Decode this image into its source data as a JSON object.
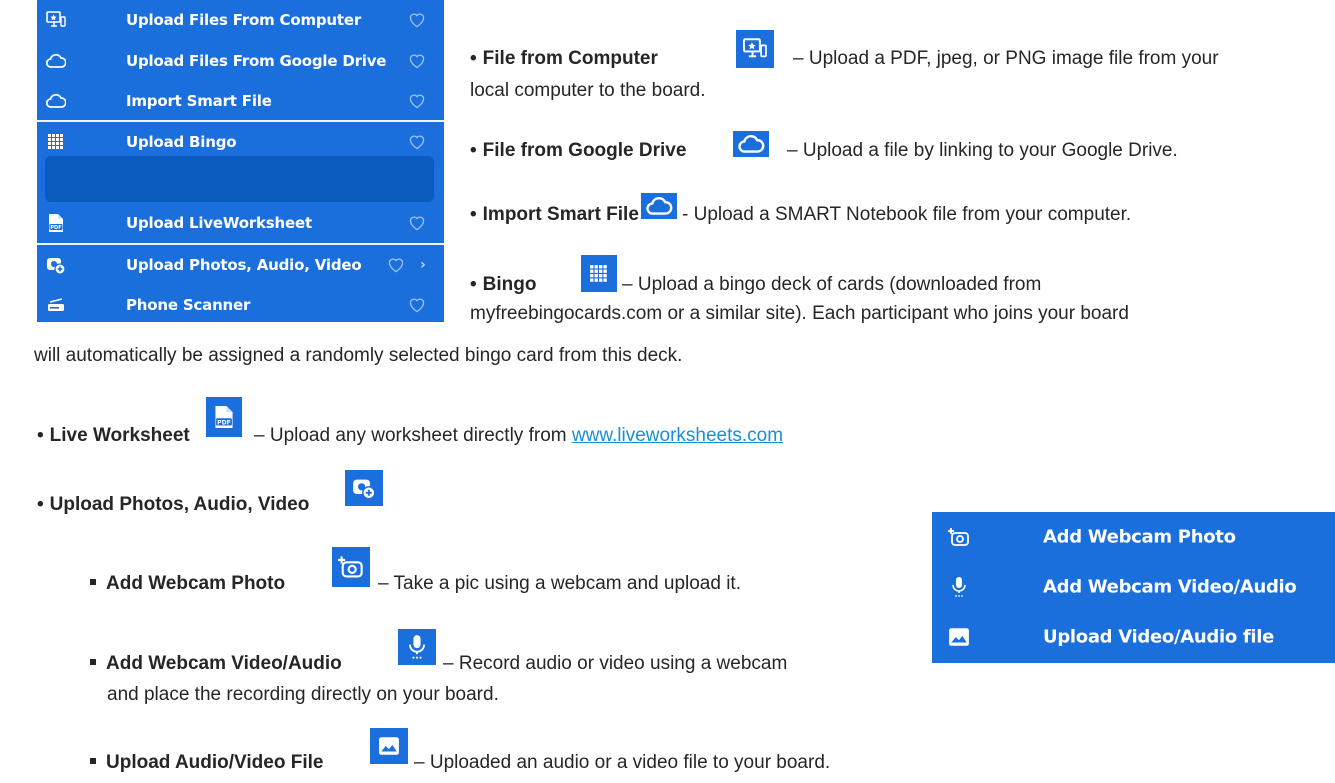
{
  "menu": {
    "items": [
      {
        "label": "Upload Files From Computer",
        "icon": "computer-upload-icon"
      },
      {
        "label": "Upload Files From Google Drive",
        "icon": "cloud-icon"
      },
      {
        "label": "Import Smart File",
        "icon": "cloud-icon"
      },
      {
        "label": "Upload Bingo",
        "icon": "bingo-grid-icon"
      },
      {
        "label": "Upload LiveWorksheet",
        "icon": "pdf-file-icon"
      },
      {
        "label": "Upload Photos, Audio, Video",
        "icon": "media-upload-icon"
      },
      {
        "label": "Phone Scanner",
        "icon": "scanner-icon"
      }
    ]
  },
  "descriptions": {
    "computer": {
      "title": "File from Computer",
      "text": "– Upload a PDF, jpeg, or PNG image file from your",
      "text2": "local computer to the board."
    },
    "gdrive": {
      "title": "File from Google Drive",
      "text": "– Upload a file by linking to your Google Drive."
    },
    "smart": {
      "title": "Import Smart File",
      "text": "- Upload a SMART Notebook file from your computer."
    },
    "bingo": {
      "title": "Bingo",
      "text": "– Upload a bingo deck of cards (downloaded from",
      "text2": "myfreebingocards.com or a similar site). Each participant who joins your board",
      "text3": "will automatically be assigned a randomly selected bingo card from this deck."
    },
    "worksheet": {
      "title": "Live Worksheet",
      "text": "– Upload any worksheet directly from",
      "link": "www.liveworksheets.com"
    },
    "media": {
      "title": "Upload Photos, Audio, Video"
    },
    "webcam_photo": {
      "title": "Add Webcam Photo",
      "text": "– Take a pic using a webcam and upload it."
    },
    "webcam_video": {
      "title": "Add Webcam Video/Audio",
      "text": "– Record audio or video using a webcam",
      "text2": "and place the recording directly on your board."
    },
    "upload_av": {
      "title": "Upload Audio/Video File",
      "text": "– Uploaded an audio or a video file to your board."
    }
  },
  "cam_menu": {
    "items": [
      {
        "label": "Add Webcam Photo",
        "icon": "add-photo-camera-icon"
      },
      {
        "label": "Add Webcam Video/Audio",
        "icon": "microphone-icon"
      },
      {
        "label": "Upload Video/Audio file",
        "icon": "image-file-icon"
      }
    ]
  },
  "colors": {
    "menu_bg": "#1a6fdc",
    "hover_bg": "#0a5bbd",
    "link": "#1a8fd6"
  }
}
